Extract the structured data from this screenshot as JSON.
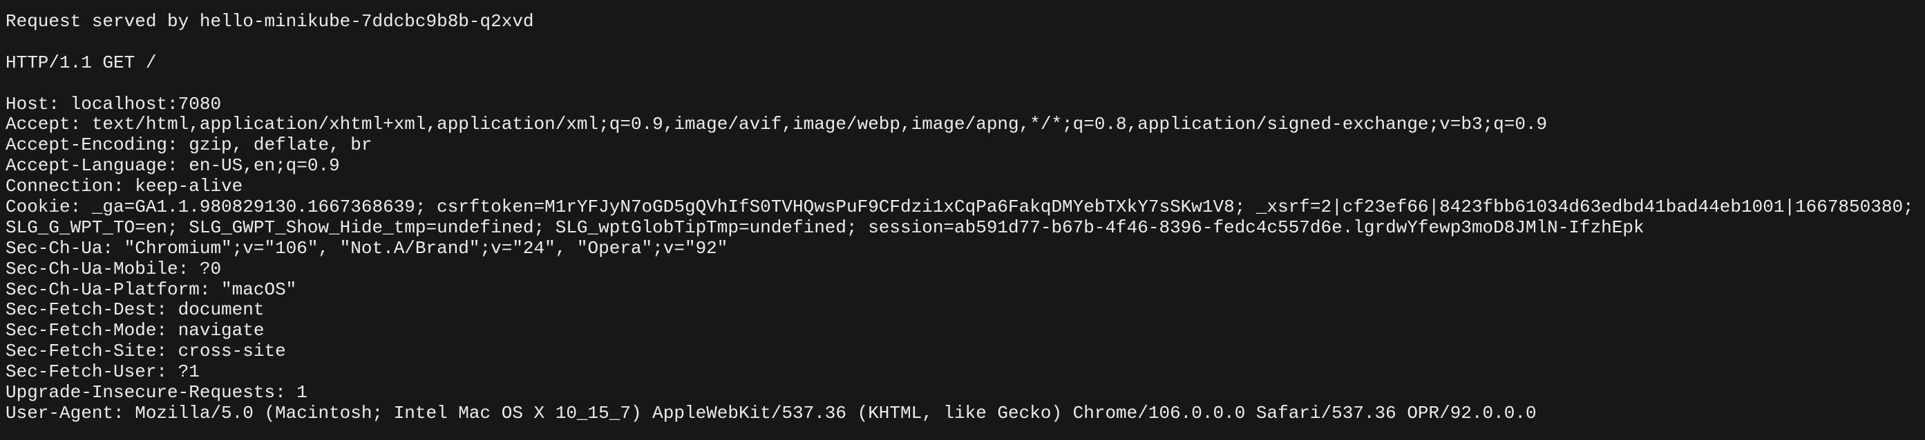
{
  "served_by": "Request served by hello-minikube-7ddcbc9b8b-q2xvd",
  "request_line": "HTTP/1.1 GET /",
  "headers": [
    "Host: localhost:7080",
    "Accept: text/html,application/xhtml+xml,application/xml;q=0.9,image/avif,image/webp,image/apng,*/*;q=0.8,application/signed-exchange;v=b3;q=0.9",
    "Accept-Encoding: gzip, deflate, br",
    "Accept-Language: en-US,en;q=0.9",
    "Connection: keep-alive",
    "Cookie: _ga=GA1.1.980829130.1667368639; csrftoken=M1rYFJyN7oGD5gQVhIfS0TVHQwsPuF9CFdzi1xCqPa6FakqDMYebTXkY7sSKw1V8; _xsrf=2|cf23ef66|8423fbb61034d63edbd41bad44eb1001|1667850380;",
    "SLG_G_WPT_TO=en; SLG_GWPT_Show_Hide_tmp=undefined; SLG_wptGlobTipTmp=undefined; session=ab591d77-b67b-4f46-8396-fedc4c557d6e.lgrdwYfewp3moD8JMlN-IfzhEpk",
    "Sec-Ch-Ua: \"Chromium\";v=\"106\", \"Not.A/Brand\";v=\"24\", \"Opera\";v=\"92\"",
    "Sec-Ch-Ua-Mobile: ?0",
    "Sec-Ch-Ua-Platform: \"macOS\"",
    "Sec-Fetch-Dest: document",
    "Sec-Fetch-Mode: navigate",
    "Sec-Fetch-Site: cross-site",
    "Sec-Fetch-User: ?1",
    "Upgrade-Insecure-Requests: 1",
    "User-Agent: Mozilla/5.0 (Macintosh; Intel Mac OS X 10_15_7) AppleWebKit/537.36 (KHTML, like Gecko) Chrome/106.0.0.0 Safari/537.36 OPR/92.0.0.0"
  ]
}
